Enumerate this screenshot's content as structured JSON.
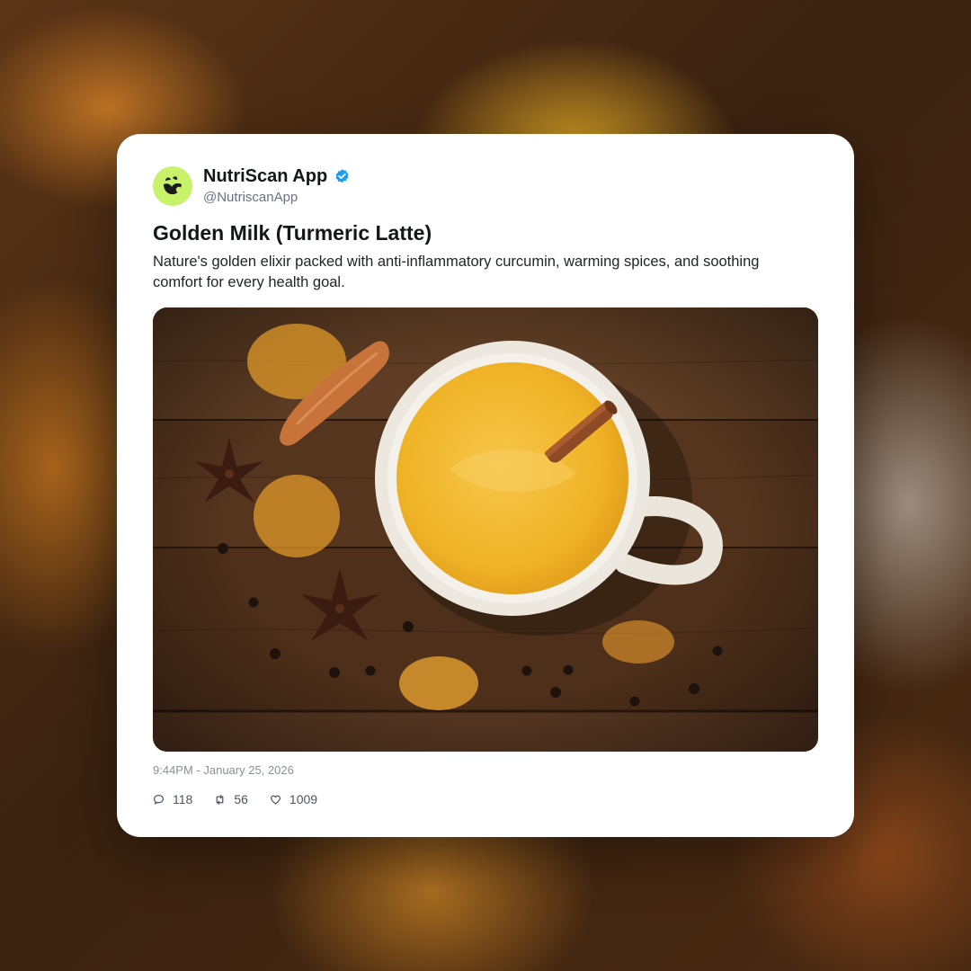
{
  "post": {
    "display_name": "NutriScan App",
    "verified": true,
    "handle": "@NutriscanApp",
    "title": "Golden Milk (Turmeric Latte)",
    "text": "Nature's golden elixir packed with anti-inflammatory curcumin, warming spices, and soothing comfort for every health goal.",
    "timestamp": "9:44PM - January 25, 2026",
    "stats": {
      "replies": "118",
      "reposts": "56",
      "likes": "1009"
    }
  },
  "colors": {
    "avatar_bg": "#c8f26a",
    "verified_blue": "#1d9bf0",
    "card_bg": "#ffffff"
  },
  "icons": {
    "avatar": "leaf-logo-icon",
    "verified": "verified-badge-icon",
    "replies": "comment-icon",
    "reposts": "repost-icon",
    "likes": "heart-icon"
  }
}
